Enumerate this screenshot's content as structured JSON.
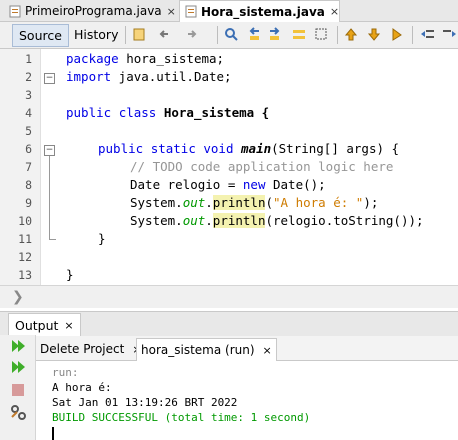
{
  "file_tabs": [
    {
      "label": "PrimeiroPrograma.java",
      "close": "×",
      "active": false
    },
    {
      "label": "Hora_sistema.java",
      "close": "×",
      "active": true
    }
  ],
  "toolbar": {
    "source_label": "Source",
    "history_label": "History"
  },
  "editor": {
    "line_numbers": [
      "1",
      "2",
      "3",
      "4",
      "5",
      "6",
      "7",
      "8",
      "9",
      "10",
      "11",
      "12",
      "13"
    ],
    "line1_package_kw": "package",
    "line1_rest": " hora_sistema;",
    "line2_import_kw": "import",
    "line2_rest": " java.util.Date;",
    "line4_public": "public",
    "line4_class": "class",
    "line4_name": " Hora_sistema {",
    "line6_public": "public",
    "line6_static": "static",
    "line6_void": "void",
    "line6_main": "main",
    "line6_rest": "(String[] args) {",
    "line7_comment": "// TODO code application logic here",
    "line8_a": "Date relogio = ",
    "line8_new": "new",
    "line8_b": " Date();",
    "line9_a": "System.",
    "line9_out": "out",
    "line9_dot": ".",
    "line9_println": "println",
    "line9_paren": "(",
    "line9_str": "\"A hora é: \"",
    "line9_end": ");",
    "line10_a": "System.",
    "line10_out": "out",
    "line10_dot": ".",
    "line10_println": "println",
    "line10_end": "(relogio.toString());",
    "line11_brace": "}",
    "line13_brace": "}",
    "fold_minus": "−"
  },
  "output": {
    "tab_label": "Output",
    "tab_close": "×",
    "subtabs": [
      {
        "label": "Delete Project",
        "close": "×",
        "active": false
      },
      {
        "label": "hora_sistema (run)",
        "close": "×",
        "active": true
      }
    ],
    "console_lines": [
      "run:",
      "A hora é:",
      "Sat Jan 01 13:19:26 BRT 2022",
      "BUILD SUCCESSFUL (total time: 1 second)"
    ]
  },
  "colors": {
    "keyword": "#0000e6",
    "comment": "#969696",
    "string": "#ce7b00",
    "field": "#009900",
    "console_run": "#888888",
    "console_success": "#009900",
    "highlight": "#f4f2b0"
  },
  "icons": [
    "java-file-icon",
    "back-icon",
    "forward-icon",
    "search-icon",
    "find-previous-icon",
    "find-next-icon",
    "toggle-highlight-icon",
    "bookmark-icon",
    "shift-left-icon",
    "shift-right-icon",
    "run-icon",
    "rerun-icon",
    "stop-icon",
    "settings-icon"
  ]
}
